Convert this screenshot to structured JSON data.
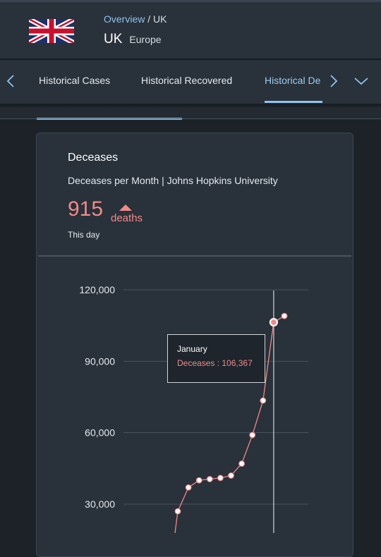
{
  "header": {
    "flag_icon": "uk-flag-icon",
    "breadcrumb_link": "Overview",
    "breadcrumb_separator": "/",
    "breadcrumb_current": "UK",
    "country": "UK",
    "region": "Europe"
  },
  "tabs": {
    "items": [
      {
        "label": "Historical Cases"
      },
      {
        "label": "Historical Recovered"
      },
      {
        "label": "Historical De"
      }
    ],
    "active_index": 2,
    "accent_color": "#8fc3f1"
  },
  "card": {
    "title": "Deceases",
    "subtitle": "Deceases per Month | Johns Hopkins University",
    "kpi_value": "915",
    "kpi_unit": "deaths",
    "kpi_trend": "up",
    "kpi_note": "This day",
    "kpi_color": "#f08a8a"
  },
  "tooltip": {
    "title": "January",
    "value": "Deceases : 106,367"
  },
  "chart_data": {
    "type": "line",
    "title": "",
    "xlabel": "",
    "ylabel": "",
    "y_ticks": [
      "120,000",
      "90,000",
      "60,000",
      "30,000"
    ],
    "ylim": [
      0,
      120000
    ],
    "grid": true,
    "series": [
      {
        "values": [
          27000,
          37000,
          40000,
          40500,
          41000,
          42000,
          47000,
          59000,
          73500,
          106367,
          109000
        ]
      }
    ],
    "highlight_index": 9,
    "line_color": "#f08a8a"
  }
}
